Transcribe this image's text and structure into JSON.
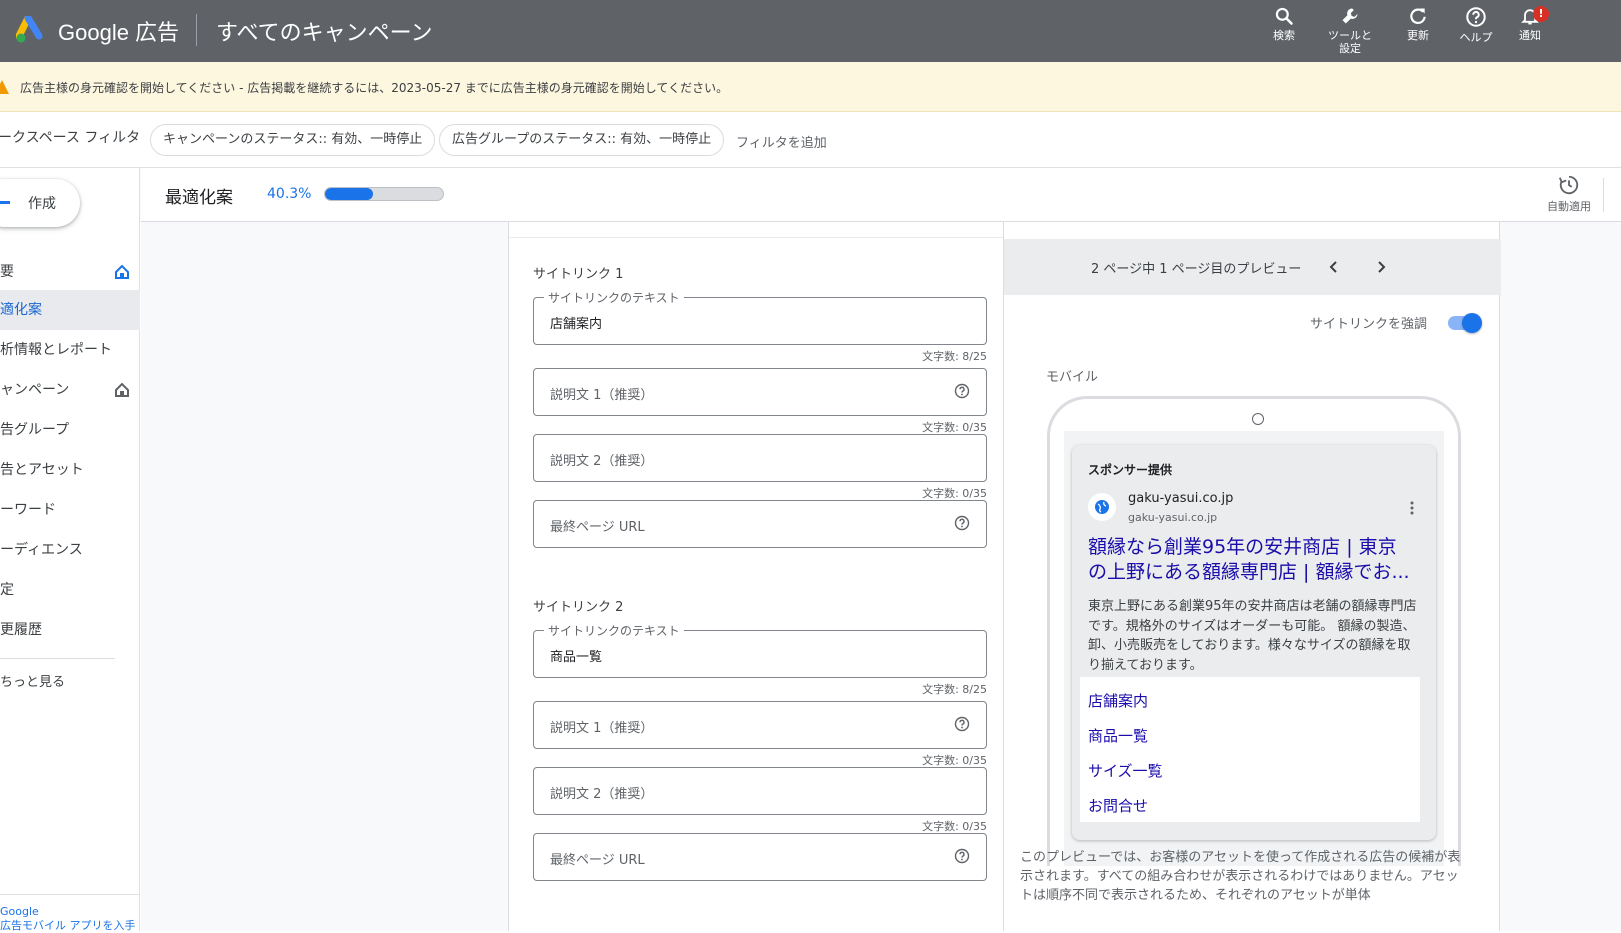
{
  "header": {
    "brand": "Google 広告",
    "page_title": "すべてのキャンペーン",
    "actions": [
      {
        "label": "検索",
        "icon": "search-icon"
      },
      {
        "label": "ツールと\n設定",
        "icon": "wrench-icon"
      },
      {
        "label": "更新",
        "icon": "refresh-icon"
      },
      {
        "label": "ヘルプ",
        "icon": "help-icon"
      },
      {
        "label": "通知",
        "icon": "bell-icon",
        "badge": "!"
      }
    ]
  },
  "banner": {
    "text": "広告主様の身元確認を開始してください - 広告掲載を継続するには、2023-05-27 までに広告主様の身元確認を開始してください。"
  },
  "filters": {
    "workspace_label": "ークスペース フィルタ",
    "chips": [
      "キャンペーンのステータス:: 有効、一時停止",
      "広告グループのステータス:: 有効、一時停止"
    ],
    "add_filter": "フィルタを追加"
  },
  "sidebar": {
    "create_label": "作成",
    "items": [
      {
        "label": "要",
        "icon": "home-icon"
      },
      {
        "label": "適化案",
        "active": true
      },
      {
        "label": "析情報とレポート"
      },
      {
        "label": "ャンペーン",
        "icon": "home-icon"
      },
      {
        "label": "告グループ"
      },
      {
        "label": "告とアセット"
      },
      {
        "label": "ーワード"
      },
      {
        "label": "ーディエンス"
      },
      {
        "label": "定"
      },
      {
        "label": "更履歴"
      }
    ],
    "more_label": "ちっと見る",
    "footer_line1": "Google",
    "footer_line2": "広告モバイル アプリを入手"
  },
  "optimization": {
    "label": "最適化案",
    "score_text": "40.3%",
    "score_value": 0.403,
    "auto_apply_label": "自動適用"
  },
  "editor": {
    "sitelinks": [
      {
        "title": "サイトリンク 1",
        "text_legend": "サイトリンクのテキスト",
        "text_value": "店舗案内",
        "text_counter": "文字数: 8/25",
        "desc1_placeholder": "説明文 1（推奨）",
        "desc1_counter": "文字数: 0/35",
        "desc2_placeholder": "説明文 2（推奨）",
        "desc2_counter": "文字数: 0/35",
        "url_placeholder": "最終ページ URL"
      },
      {
        "title": "サイトリンク 2",
        "text_legend": "サイトリンクのテキスト",
        "text_value": "商品一覧",
        "text_counter": "文字数: 8/25",
        "desc1_placeholder": "説明文 1（推奨）",
        "desc1_counter": "文字数: 0/35",
        "desc2_placeholder": "説明文 2（推奨）",
        "desc2_counter": "文字数: 0/35",
        "url_placeholder": "最終ページ URL"
      }
    ]
  },
  "preview": {
    "page_text": "2 ページ中 1 ページ目のプレビュー",
    "emphasize_label": "サイトリンクを強調",
    "emphasize_on": true,
    "mobile_label": "モバイル",
    "ad": {
      "sponsor": "スポンサー提供",
      "domain": "gaku-yasui.co.jp",
      "url": "gaku-yasui.co.jp",
      "headline_line1": "額縁なら創業95年の安井商店 | 東京",
      "headline_line2": "の上野にある額縁専門店 | 額縁でお...",
      "description": "東京上野にある創業95年の安井商店は老舗の額縁専門店です。規格外のサイズはオーダーも可能。 額縁の製造、卸、小売販売をしております。様々なサイズの額縁を取り揃えております。",
      "sitelinks": [
        "店舗案内",
        "商品一覧",
        "サイズ一覧",
        "お問合せ"
      ]
    },
    "note": "このプレビューでは、お客様のアセットを使って作成される広告の候補が表示されます。すべての組み合わせが表示されるわけではありません。アセットは順序不同で表示されるため、それぞれのアセットが単体"
  },
  "colors": {
    "topbar": "#5f6368",
    "accent": "#1a73e8",
    "banner": "#fef7e0",
    "ad_link": "#1a0dab"
  }
}
